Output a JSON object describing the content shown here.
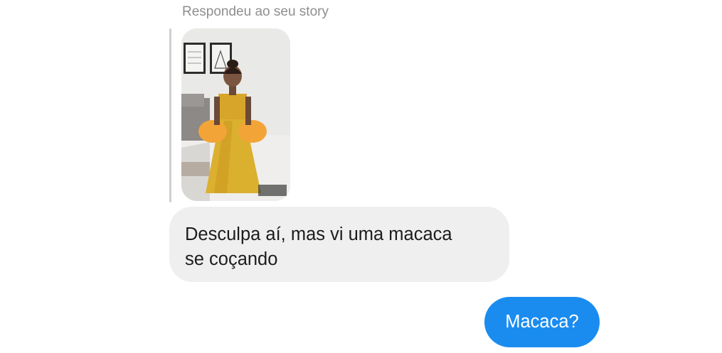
{
  "reply_caption": "Respondeu ao seu story",
  "story": {
    "image_description": "story photo thumbnail"
  },
  "messages": [
    {
      "direction": "incoming",
      "lines": [
        "Desculpa aí, mas vi uma macaca",
        "se coçando"
      ]
    },
    {
      "direction": "outgoing",
      "text": "Macaca?"
    }
  ],
  "colors": {
    "incoming_bubble": "#efeff0",
    "outgoing_bubble": "#1a8cf0",
    "caption_text": "#8e8e8e"
  }
}
